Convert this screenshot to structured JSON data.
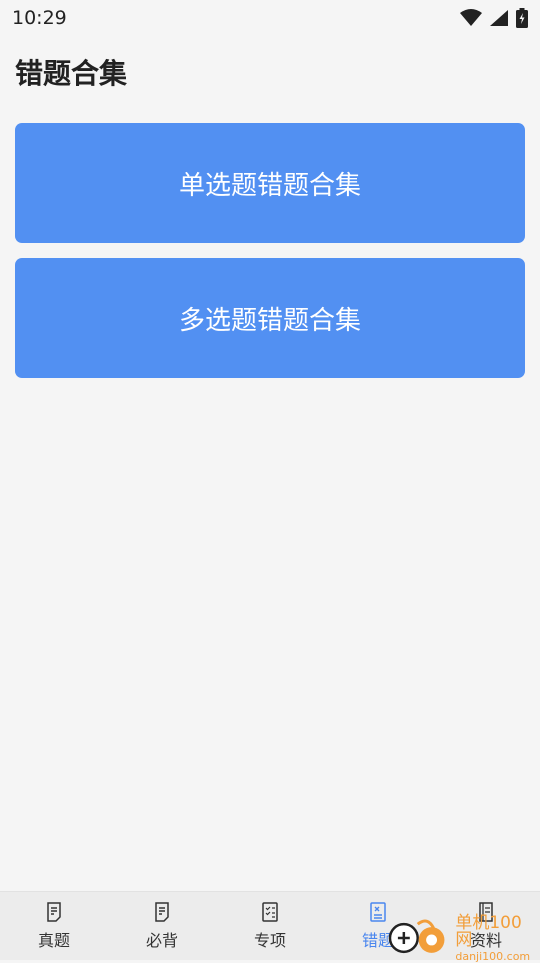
{
  "status_bar": {
    "time": "10:29",
    "icons": [
      "wifi-icon",
      "signal-icon",
      "battery-charging-icon"
    ]
  },
  "header": {
    "title": "错题合集"
  },
  "cards": [
    {
      "label": "单选题错题合集"
    },
    {
      "label": "多选题错题合集"
    }
  ],
  "bottom_nav": {
    "active_index": 3,
    "items": [
      {
        "label": "真题",
        "icon": "document-icon"
      },
      {
        "label": "必背",
        "icon": "document-icon"
      },
      {
        "label": "专项",
        "icon": "checklist-icon"
      },
      {
        "label": "错题",
        "icon": "wrong-document-icon"
      },
      {
        "label": "资料",
        "icon": "book-icon"
      }
    ]
  },
  "watermark": {
    "title": "单机100网",
    "url": "danji100.com"
  },
  "colors": {
    "card_blue": "#5290f2",
    "active_nav": "#4a86ee",
    "background": "#f5f5f5"
  }
}
